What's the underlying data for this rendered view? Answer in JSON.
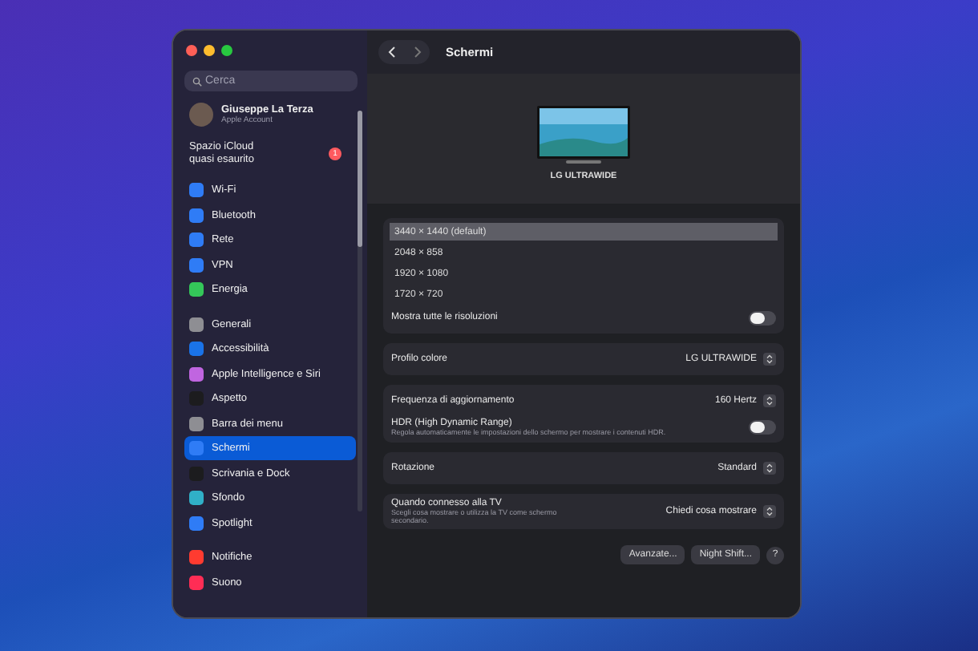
{
  "sidebar": {
    "search": {
      "placeholder": "Cerca"
    },
    "account": {
      "name": "Giuseppe La Terza",
      "subtitle": "Apple Account"
    },
    "notice": {
      "text": "Spazio iCloud quasi esaurito",
      "badge": "1"
    },
    "groups": [
      [
        {
          "label": "Wi-Fi",
          "color": "#2f7cf6",
          "selected": false
        },
        {
          "label": "Bluetooth",
          "color": "#2f7cf6",
          "selected": false
        },
        {
          "label": "Rete",
          "color": "#2f7cf6",
          "selected": false
        },
        {
          "label": "VPN",
          "color": "#2f7cf6",
          "selected": false
        },
        {
          "label": "Energia",
          "color": "#34c759",
          "selected": false
        }
      ],
      [
        {
          "label": "Generali",
          "color": "#8e8e93",
          "selected": false
        },
        {
          "label": "Accessibilità",
          "color": "#1a73e8",
          "selected": false
        },
        {
          "label": "Apple Intelligence e Siri",
          "color": "#c065e0",
          "selected": false
        },
        {
          "label": "Aspetto",
          "color": "#1c1c1e",
          "selected": false
        },
        {
          "label": "Barra dei menu",
          "color": "#8e8e93",
          "selected": false
        },
        {
          "label": "Schermi",
          "color": "#2f7cf6",
          "selected": true
        },
        {
          "label": "Scrivania e Dock",
          "color": "#1c1c1e",
          "selected": false
        },
        {
          "label": "Sfondo",
          "color": "#30b0c7",
          "selected": false
        },
        {
          "label": "Spotlight",
          "color": "#2f7cf6",
          "selected": false
        }
      ],
      [
        {
          "label": "Notifiche",
          "color": "#ff3b30",
          "selected": false
        },
        {
          "label": "Suono",
          "color": "#ff2d55",
          "selected": false
        }
      ]
    ]
  },
  "toolbar": {
    "title": "Schermi"
  },
  "display": {
    "name": "LG ULTRAWIDE"
  },
  "resolutions": [
    {
      "label": "3440 × 1440 (default)",
      "selected": true
    },
    {
      "label": "2048 × 858",
      "selected": false
    },
    {
      "label": "1920 × 1080",
      "selected": false
    },
    {
      "label": "1720 × 720",
      "selected": false
    }
  ],
  "show_all": {
    "label": "Mostra tutte le risoluzioni",
    "on": false
  },
  "cards": [
    [
      {
        "kind": "popup",
        "label": "Profilo colore",
        "value": "LG ULTRAWIDE"
      }
    ],
    [
      {
        "kind": "popup",
        "label": "Frequenza di aggiornamento",
        "value": "160 Hertz"
      },
      {
        "kind": "toggle",
        "label": "HDR (High Dynamic Range)",
        "description": "Regola automaticamente le impostazioni dello schermo per mostrare i contenuti HDR.",
        "on": false
      }
    ],
    [
      {
        "kind": "popup",
        "label": "Rotazione",
        "value": "Standard"
      }
    ],
    [
      {
        "kind": "popup",
        "label": "Quando connesso alla TV",
        "description": "Scegli cosa mostrare o utilizza la TV come schermo secondario.",
        "value": "Chiedi cosa mostrare"
      }
    ]
  ],
  "buttons": [
    "Avanzate...",
    "Night Shift..."
  ],
  "help": "?"
}
